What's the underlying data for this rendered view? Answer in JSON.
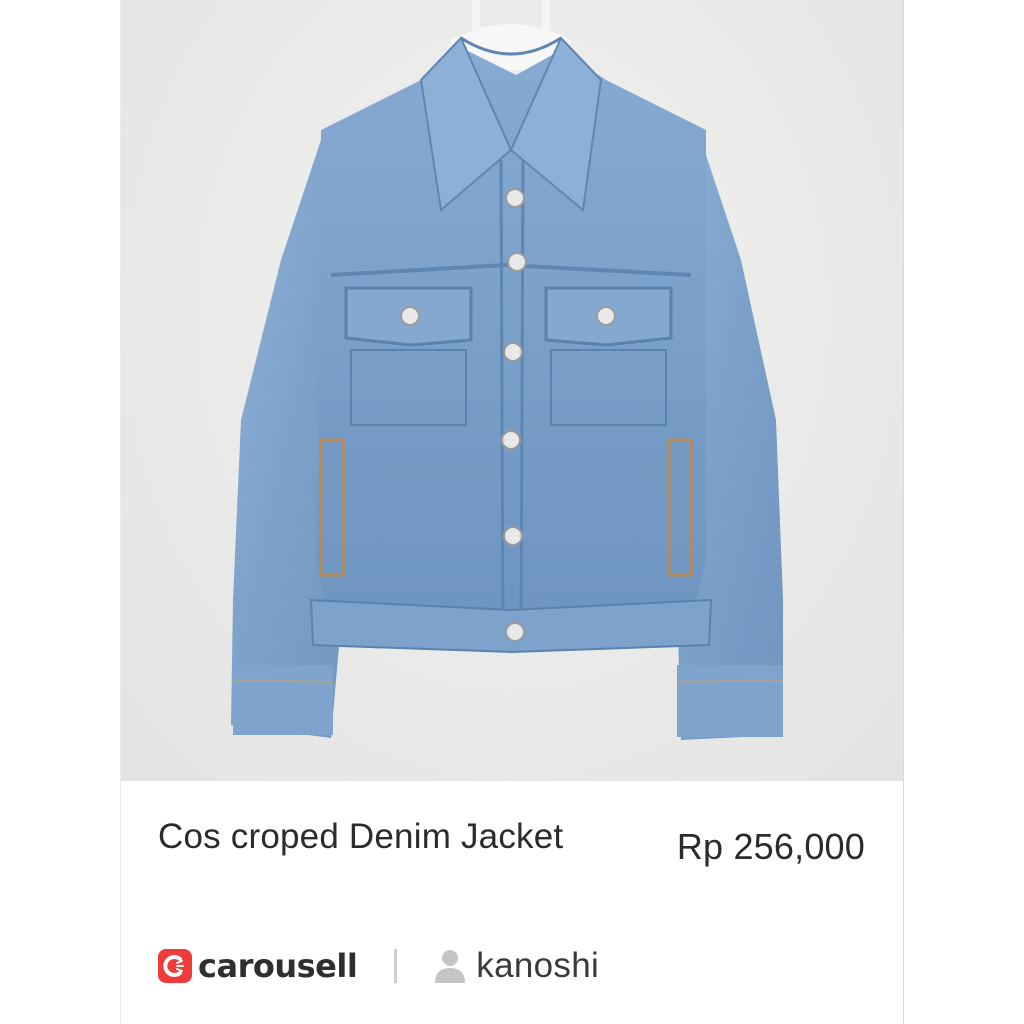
{
  "listing": {
    "title": "Cos croped Denim Jacket",
    "price": "Rp 256,000",
    "image_alt": "denim-jacket-photo"
  },
  "footer": {
    "brand_name": "carousell",
    "brand_icon": "carousell-logo-icon",
    "seller_icon": "user-icon",
    "seller_name": "kanoshi"
  },
  "colors": {
    "brand_red": "#ef3b3b",
    "text_dark": "#2b2b2b",
    "denim": "#7fa3cc",
    "photo_bg": "#e9e9e8"
  }
}
